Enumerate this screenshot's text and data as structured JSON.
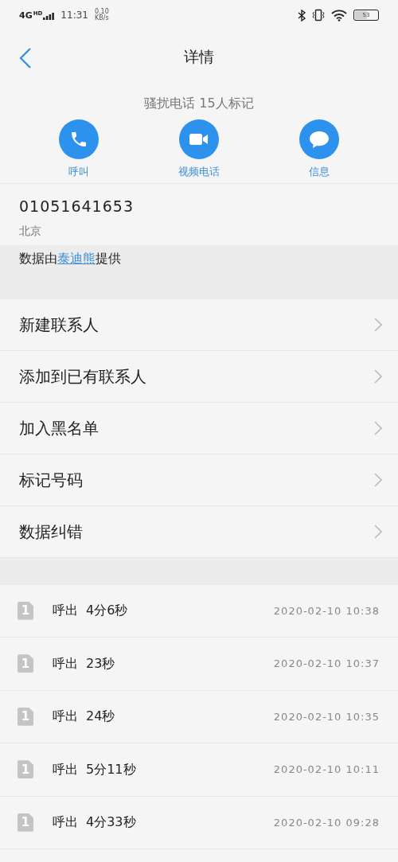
{
  "status_bar": {
    "network": "4G",
    "network_badge": "HD",
    "time": "11:31",
    "speed": "0.10",
    "speed_unit": "KB/s",
    "battery": "53"
  },
  "header": {
    "title": "详情"
  },
  "caller": {
    "tag": "骚扰电话 15人标记"
  },
  "actions": [
    {
      "kind": "call",
      "label": "呼叫"
    },
    {
      "kind": "video",
      "label": "视频电话"
    },
    {
      "kind": "message",
      "label": "信息"
    }
  ],
  "number": {
    "value": "01051641653",
    "location": "北京"
  },
  "source": {
    "before": "数据由",
    "link": "泰迪熊",
    "after": "提供"
  },
  "menu": [
    "新建联系人",
    "添加到已有联系人",
    "加入黑名单",
    "标记号码",
    "数据纠错"
  ],
  "calls": [
    {
      "sim": "1",
      "type": "呼出",
      "duration": "4分6秒",
      "time": "2020-02-10 10:38"
    },
    {
      "sim": "1",
      "type": "呼出",
      "duration": "23秒",
      "time": "2020-02-10 10:37"
    },
    {
      "sim": "1",
      "type": "呼出",
      "duration": "24秒",
      "time": "2020-02-10 10:35"
    },
    {
      "sim": "1",
      "type": "呼出",
      "duration": "5分11秒",
      "time": "2020-02-10 10:11"
    },
    {
      "sim": "1",
      "type": "呼出",
      "duration": "4分33秒",
      "time": "2020-02-10 09:28"
    }
  ]
}
